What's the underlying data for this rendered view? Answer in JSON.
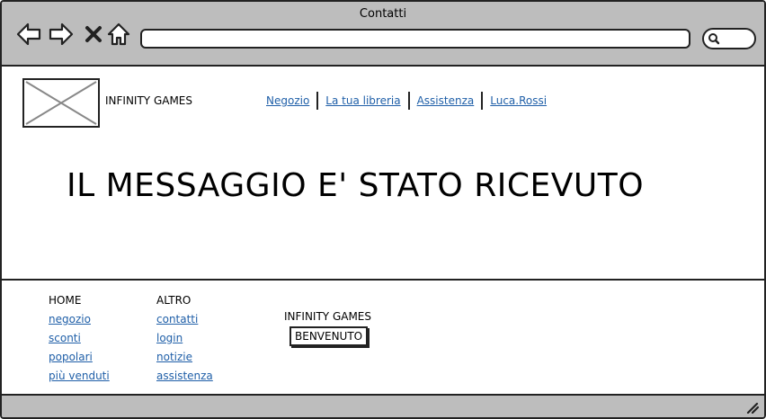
{
  "window": {
    "title": "Contatti"
  },
  "toolbar": {
    "back_icon": "arrow-left-icon",
    "forward_icon": "arrow-right-icon",
    "stop_icon": "close-icon",
    "home_icon": "home-icon",
    "search_icon": "search-icon",
    "url_value": ""
  },
  "header": {
    "brand": "INFINITY GAMES",
    "nav": [
      "Negozio",
      "La tua libreria",
      "Assistenza",
      "Luca.Rossi"
    ]
  },
  "main": {
    "headline": "IL MESSAGGIO E' STATO RICEVUTO"
  },
  "footer": {
    "col1": {
      "heading": "HOME",
      "links": [
        "negozio",
        "sconti",
        "popolari",
        "più venduti"
      ]
    },
    "col2": {
      "heading": "ALTRO",
      "links": [
        "contatti",
        "login",
        "notizie",
        "assistenza"
      ]
    },
    "brand": "INFINITY GAMES",
    "welcome": "BENVENUTO"
  },
  "colors": {
    "chrome": "#bdbdbd",
    "link": "#1f5fa8",
    "border": "#222222"
  }
}
